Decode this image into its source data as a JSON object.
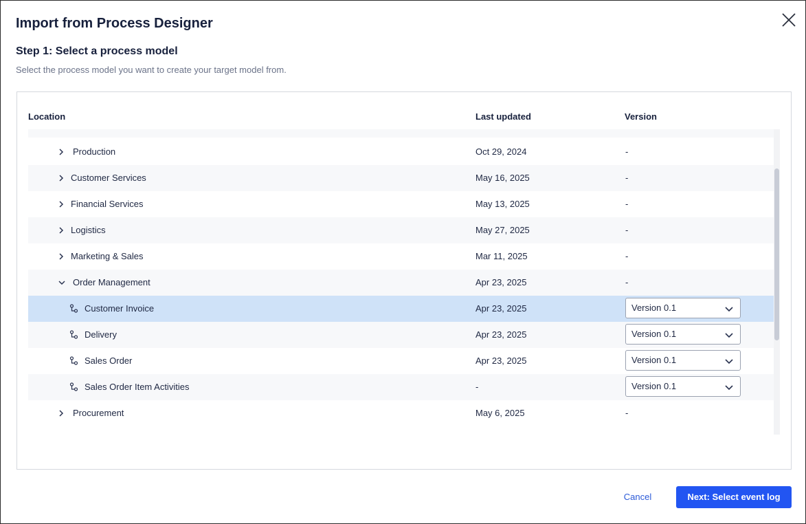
{
  "dialog": {
    "title": "Import from Process Designer",
    "close_icon": "close-icon",
    "step_title": "Step 1: Select a process model",
    "step_description": "Select the process model you want to create your target model from."
  },
  "table": {
    "headers": {
      "location": "Location",
      "last_updated": "Last updated",
      "version": "Version"
    },
    "rows": [
      {
        "name": "Production",
        "date": "Oct 29, 2024",
        "version": "-",
        "type": "folder",
        "expanded": false
      },
      {
        "name": "Customer Services",
        "date": "May 16, 2025",
        "version": "-",
        "type": "folder",
        "expanded": false
      },
      {
        "name": "Financial Services",
        "date": "May 13, 2025",
        "version": "-",
        "type": "folder",
        "expanded": false
      },
      {
        "name": "Logistics",
        "date": "May 27, 2025",
        "version": "-",
        "type": "folder",
        "expanded": false
      },
      {
        "name": "Marketing & Sales",
        "date": "Mar 11, 2025",
        "version": "-",
        "type": "folder",
        "expanded": false
      },
      {
        "name": "Order Management",
        "date": "Apr 23, 2025",
        "version": "-",
        "type": "folder",
        "expanded": true
      },
      {
        "name": "Customer Invoice",
        "date": "Apr 23, 2025",
        "version": "Version 0.1",
        "type": "model",
        "selected": true
      },
      {
        "name": "Delivery",
        "date": "Apr 23, 2025",
        "version": "Version 0.1",
        "type": "model"
      },
      {
        "name": "Sales Order",
        "date": "Apr 23, 2025",
        "version": "Version 0.1",
        "type": "model"
      },
      {
        "name": "Sales Order Item Activities",
        "date": "-",
        "version": "Version 0.1",
        "type": "model"
      },
      {
        "name": "Procurement",
        "date": "May 6, 2025",
        "version": "-",
        "type": "folder",
        "expanded": false
      }
    ]
  },
  "footer": {
    "cancel_label": "Cancel",
    "next_label": "Next: Select event log"
  },
  "colors": {
    "accent": "#2255f2",
    "selected_row": "#cfe2f8",
    "alt_row": "#f7f8fa"
  }
}
